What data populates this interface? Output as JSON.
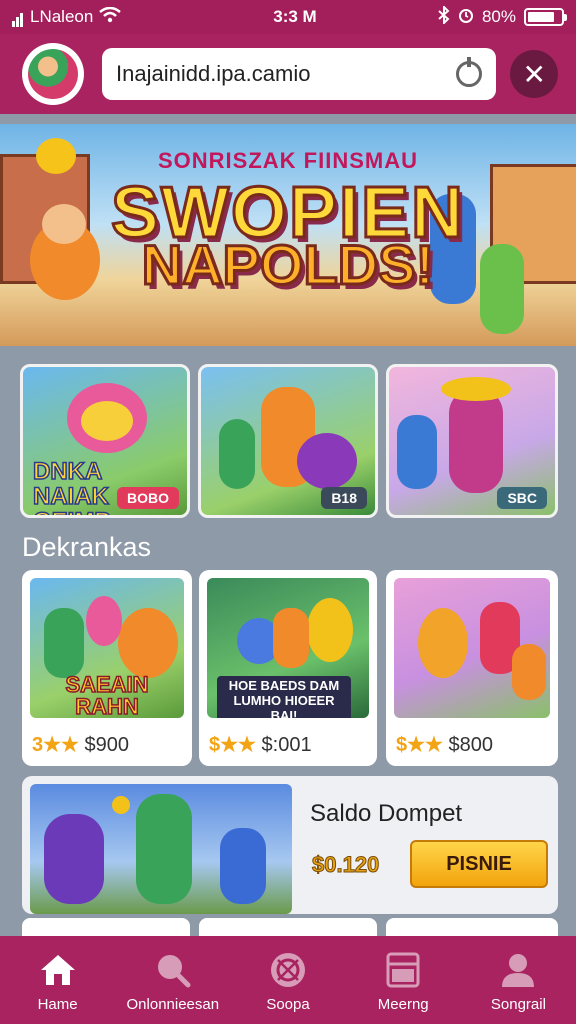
{
  "status_bar": {
    "carrier": "LNaleon",
    "time": "3:3 M",
    "battery": "80%",
    "battery_level": 0.8
  },
  "browser": {
    "url": "Inajainidd.ipa.camio",
    "close_icon": "close-icon"
  },
  "hero": {
    "subtitle": "SONRISZAK FIINSMAU",
    "title_line1": "SWOPIEN",
    "title_line2": "NAPOLDS!"
  },
  "top_tiles": [
    {
      "title": "DNKA NAIAK GEIMP",
      "tag": "BOBO"
    },
    {
      "title": "",
      "tag": "B18"
    },
    {
      "title": "",
      "tag": "SBC"
    }
  ],
  "section": {
    "title": "Dekrankas"
  },
  "cards": [
    {
      "img_title": "SAEAIN RAHN EMKIES",
      "stars": "3★★",
      "price": "$900"
    },
    {
      "img_title": "HOE BAEDS DAM LUMHO HIOEER BAI!",
      "stars": "$★★",
      "price": "$:001"
    },
    {
      "img_title": "",
      "stars": "$★★",
      "price": "$800"
    }
  ],
  "wallet": {
    "title": "Saldo Dompet",
    "amount": "$0.120",
    "button": "PISNIE"
  },
  "bottom_nav": [
    {
      "label": "Hame",
      "icon": "home-icon"
    },
    {
      "label": "Onlonnieesan",
      "icon": "search-icon"
    },
    {
      "label": "Soopa",
      "icon": "ball-icon"
    },
    {
      "label": "Meerng",
      "icon": "message-icon"
    },
    {
      "label": "Songrail",
      "icon": "profile-icon"
    }
  ],
  "colors": {
    "brand": "#a8235f",
    "accent": "#f2a40c",
    "background": "#8e9aa7"
  }
}
